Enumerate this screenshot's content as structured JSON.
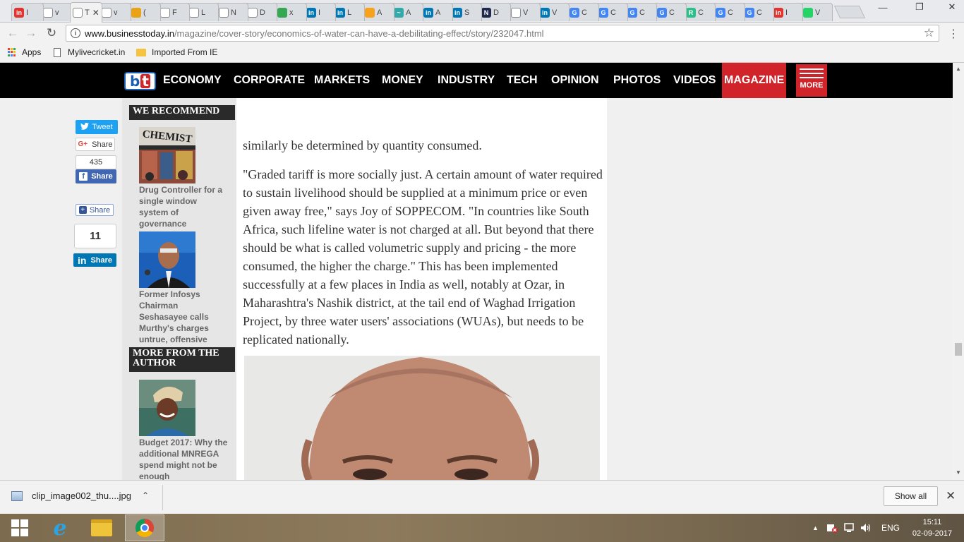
{
  "browser": {
    "tabs": [
      {
        "title": "I",
        "favicon": "in",
        "favicon_color": "#e2332f"
      },
      {
        "title": "v",
        "favicon": "",
        "favicon_color": "#ffffff"
      },
      {
        "title": "T",
        "favicon": "",
        "favicon_color": "#ffffff",
        "active": true
      },
      {
        "title": "v",
        "favicon": "",
        "favicon_color": "#ffffff"
      },
      {
        "title": "(",
        "favicon": "",
        "favicon_color": "#e8a317"
      },
      {
        "title": "F",
        "favicon": "",
        "favicon_color": "#ffffff"
      },
      {
        "title": "L",
        "favicon": "",
        "favicon_color": "#ffffff"
      },
      {
        "title": "N",
        "favicon": "",
        "favicon_color": "#ffffff"
      },
      {
        "title": "D",
        "favicon": "",
        "favicon_color": "#ffffff"
      },
      {
        "title": "x",
        "favicon": "",
        "favicon_color": "#34a853"
      },
      {
        "title": "I",
        "favicon": "in",
        "favicon_color": "#0077b5"
      },
      {
        "title": "L",
        "favicon": "in",
        "favicon_color": "#0077b5"
      },
      {
        "title": "A",
        "favicon": "",
        "favicon_color": "#f7a21b"
      },
      {
        "title": "A",
        "favicon": "~",
        "favicon_color": "#3aa"
      },
      {
        "title": "A",
        "favicon": "in",
        "favicon_color": "#0077b5"
      },
      {
        "title": "S",
        "favicon": "in",
        "favicon_color": "#0077b5"
      },
      {
        "title": "D",
        "favicon": "N",
        "favicon_color": "#1d2a4d"
      },
      {
        "title": "V",
        "favicon": "",
        "favicon_color": "#ffffff"
      },
      {
        "title": "V",
        "favicon": "in",
        "favicon_color": "#0077b5"
      },
      {
        "title": "C",
        "favicon": "G",
        "favicon_color": "#4285f4"
      },
      {
        "title": "C",
        "favicon": "G",
        "favicon_color": "#4285f4"
      },
      {
        "title": "C",
        "favicon": "G",
        "favicon_color": "#4285f4"
      },
      {
        "title": "C",
        "favicon": "G",
        "favicon_color": "#4285f4"
      },
      {
        "title": "C",
        "favicon": "R",
        "favicon_color": "#2bbf8a"
      },
      {
        "title": "C",
        "favicon": "G",
        "favicon_color": "#4285f4"
      },
      {
        "title": "C",
        "favicon": "G",
        "favicon_color": "#4285f4"
      },
      {
        "title": "I",
        "favicon": "in",
        "favicon_color": "#e2332f"
      },
      {
        "title": "V",
        "favicon": "",
        "favicon_color": "#25d366"
      }
    ],
    "url_host": "www.businesstoday.in",
    "url_path": "/magazine/cover-story/economics-of-water-can-have-a-debilitating-effect/story/232047.html",
    "bookmarks": {
      "apps": "Apps",
      "item1": "Mylivecricket.in",
      "item2": "Imported From IE"
    }
  },
  "site": {
    "logo": {
      "b": "b",
      "t": "t"
    },
    "nav": [
      "ECONOMY",
      "CORPORATE",
      "MARKETS",
      "MONEY",
      "INDUSTRY",
      "TECH",
      "OPINION",
      "PHOTOS",
      "VIDEOS",
      "MAGAZINE"
    ],
    "more_label": "MORE",
    "brand_red": "#d1232a"
  },
  "share": {
    "tweet": "Tweet",
    "gplus_icon": "G+",
    "gplus": "Share",
    "fb_count": "435",
    "fb_icon": "f",
    "fb_share": "Share",
    "addthis_share": "Share",
    "li_count": "11",
    "li_icon": "in",
    "li_share": "Share"
  },
  "sidebar": {
    "recommend_title": "WE RECOMMEND",
    "recommend": [
      {
        "caption": "Drug Controller for a single window system of governance",
        "image_text": "CHEMIST"
      },
      {
        "caption": "Former Infosys Chairman Seshasayee calls Murthy's charges untrue, offensive"
      }
    ],
    "author_title": "MORE FROM THE AUTHOR",
    "author_items": [
      {
        "caption": "Budget 2017: Why the additional MNREGA spend might not be enough"
      }
    ]
  },
  "article": {
    "para1": "similarly be determined by quantity consumed.",
    "para2": "\"Graded tariff is more socially just. A certain amount of water required to sustain livelihood should be supplied at a minimum price or even given away free,\" says Joy of SOPPECOM. \"In countries like South Africa, such lifeline water is not charged at all. But beyond that there should be what is called volumetric supply and pricing - the more consumed, the higher the charge.\" This has been implemented successfully at a few places in India as well, notably at Ozar, in Maharashtra's Nashik district, at the tail end of Waghad Irrigation Project, by three water users' associations (WUAs), but needs to be replicated nationally."
  },
  "downloads": {
    "file": "clip_image002_thu....jpg",
    "show_all": "Show all"
  },
  "taskbar": {
    "lang": "ENG",
    "time": "15:11",
    "date": "02-09-2017"
  }
}
